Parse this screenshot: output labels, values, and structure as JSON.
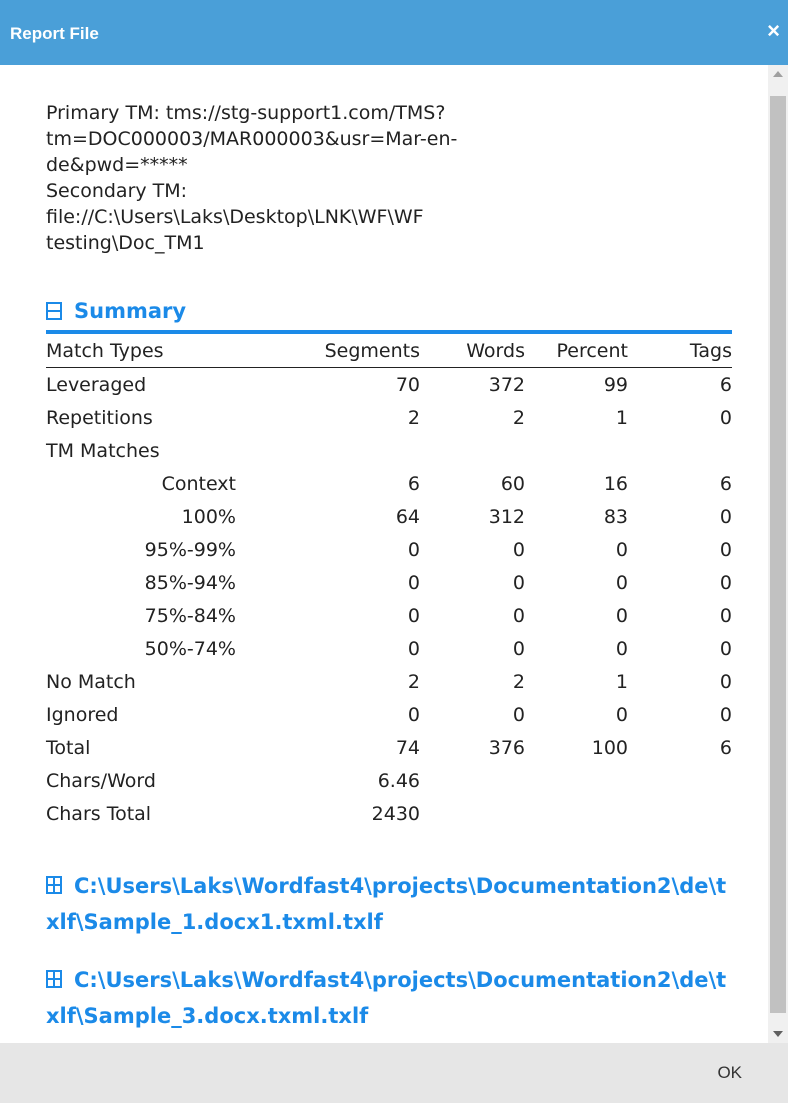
{
  "dialog": {
    "title": "Report File",
    "close_glyph": "×"
  },
  "tm_info": {
    "line1": "Primary TM: tms://stg-support1.com/TMS?",
    "line2": "tm=DOC000003/MAR000003&usr=Mar-en-",
    "line3": "de&pwd=*****",
    "line4": "Secondary TM:",
    "line5": "file://C:\\Users\\Laks\\Desktop\\LNK\\WF\\WF",
    "line6": "testing\\Doc_TM1"
  },
  "summary": {
    "heading": "Summary",
    "columns": [
      "Match Types",
      "Segments",
      "Words",
      "Percent",
      "Tags"
    ],
    "rows": [
      {
        "label": "Leveraged",
        "segments": "70",
        "words": "372",
        "percent": "99",
        "tags": "6",
        "indent": false
      },
      {
        "label": "Repetitions",
        "segments": "2",
        "words": "2",
        "percent": "1",
        "tags": "0",
        "indent": false
      },
      {
        "label": "TM Matches",
        "segments": "",
        "words": "",
        "percent": "",
        "tags": "",
        "indent": false
      },
      {
        "label": "Context",
        "segments": "6",
        "words": "60",
        "percent": "16",
        "tags": "6",
        "indent": true
      },
      {
        "label": "100%",
        "segments": "64",
        "words": "312",
        "percent": "83",
        "tags": "0",
        "indent": true
      },
      {
        "label": "95%-99%",
        "segments": "0",
        "words": "0",
        "percent": "0",
        "tags": "0",
        "indent": true
      },
      {
        "label": "85%-94%",
        "segments": "0",
        "words": "0",
        "percent": "0",
        "tags": "0",
        "indent": true
      },
      {
        "label": "75%-84%",
        "segments": "0",
        "words": "0",
        "percent": "0",
        "tags": "0",
        "indent": true
      },
      {
        "label": "50%-74%",
        "segments": "0",
        "words": "0",
        "percent": "0",
        "tags": "0",
        "indent": true
      },
      {
        "label": "No Match",
        "segments": "2",
        "words": "2",
        "percent": "1",
        "tags": "0",
        "indent": false
      },
      {
        "label": "Ignored",
        "segments": "0",
        "words": "0",
        "percent": "0",
        "tags": "0",
        "indent": false
      },
      {
        "label": "Total",
        "segments": "74",
        "words": "376",
        "percent": "100",
        "tags": "6",
        "indent": false
      },
      {
        "label": "Chars/Word",
        "segments": "6.46",
        "words": "",
        "percent": "",
        "tags": "",
        "indent": false
      },
      {
        "label": "Chars Total",
        "segments": "2430",
        "words": "",
        "percent": "",
        "tags": "",
        "indent": false
      }
    ]
  },
  "files": [
    {
      "path": "C:\\Users\\Laks\\Wordfast4\\projects\\Documentation2\\de\\txlf\\Sample_1.docx1.txml.txlf"
    },
    {
      "path": "C:\\Users\\Laks\\Wordfast4\\projects\\Documentation2\\de\\txlf\\Sample_3.docx.txml.txlf"
    }
  ],
  "footer": {
    "ok_label": "OK"
  },
  "icons": {
    "summary": "collapse-box-icon",
    "file": "expand-grid-icon",
    "close": "close-icon"
  },
  "colors": {
    "titlebar": "#4a9fd8",
    "accent": "#1b8ae8",
    "footer": "#e6e6e6"
  }
}
